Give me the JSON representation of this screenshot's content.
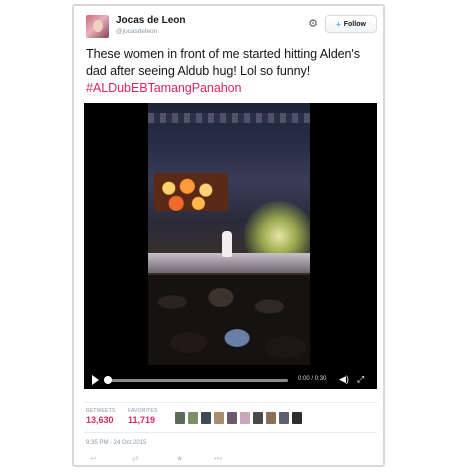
{
  "user": {
    "name": "Jocas de Leon",
    "handle": "@jocasdeleon"
  },
  "follow_label": "Follow",
  "tweet": {
    "text": "These women in front of me started hitting Alden's dad after seeing Aldub hug! Lol so funny!",
    "hashtag": "#ALDubEBTamangPanahon"
  },
  "video": {
    "time": "0:00 / 0:30",
    "progress": 0
  },
  "stats": {
    "retweets_label": "RETWEETS",
    "retweets": "13,630",
    "favorites_label": "FAVORITES",
    "favorites": "11,719"
  },
  "favoriters": [
    {
      "color": "#5c6b5a"
    },
    {
      "color": "#7b8e6a"
    },
    {
      "color": "#3f4a55"
    },
    {
      "color": "#a88e6e"
    },
    {
      "color": "#6d5a6e"
    },
    {
      "color": "#c8a7b8"
    },
    {
      "color": "#4a4a4a"
    },
    {
      "color": "#8a6f5a"
    },
    {
      "color": "#5d5d70"
    },
    {
      "color": "#2e2e2e"
    }
  ],
  "timestamp": "9:35 PM - 24 Oct 2015",
  "actions": [
    {
      "icon": "reply-icon",
      "glyph": "↩"
    },
    {
      "icon": "retweet-icon",
      "glyph": "⇄"
    },
    {
      "icon": "favorite-icon",
      "glyph": "★"
    },
    {
      "icon": "more-icon",
      "glyph": "•••"
    }
  ]
}
